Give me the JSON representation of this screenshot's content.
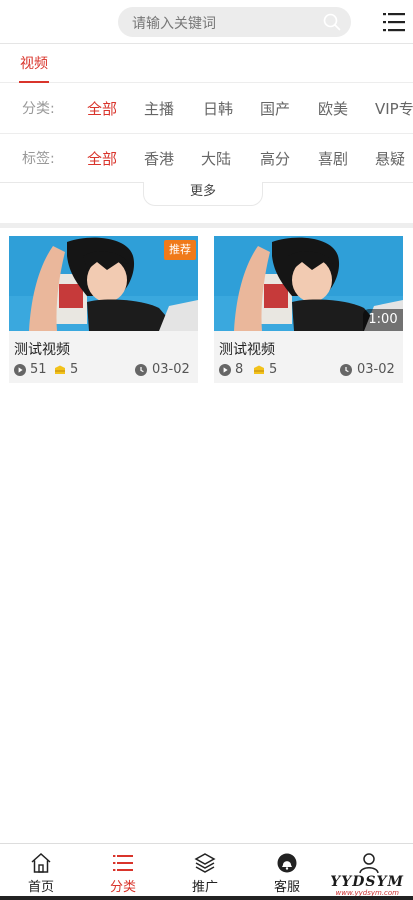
{
  "search": {
    "placeholder": "请输入关键词"
  },
  "tabs": [
    {
      "label": "视频",
      "active": true
    }
  ],
  "filters": {
    "category": {
      "label": "分类:",
      "options": [
        "全部",
        "主播",
        "日韩",
        "国产",
        "欧美",
        "VIP专"
      ],
      "active_index": 0
    },
    "tag": {
      "label": "标签:",
      "options": [
        "全部",
        "香港",
        "大陆",
        "高分",
        "喜剧",
        "悬疑"
      ],
      "active_index": 0
    }
  },
  "more_label": "更多",
  "videos": [
    {
      "title": "测试视频",
      "badge": "推荐",
      "duration": "",
      "plays": "51",
      "coins": "5",
      "date": "03-02"
    },
    {
      "title": "测试视频",
      "badge": "",
      "duration": "1:00",
      "plays": "8",
      "coins": "5",
      "date": "03-02"
    }
  ],
  "bottom_nav": [
    {
      "label": "首页",
      "icon": "home-icon",
      "active": false
    },
    {
      "label": "分类",
      "icon": "category-list-icon",
      "active": true
    },
    {
      "label": "推广",
      "icon": "layers-icon",
      "active": false
    },
    {
      "label": "客服",
      "icon": "customer-service-icon",
      "active": false
    },
    {
      "label": "我的",
      "icon": "user-icon",
      "active": false
    }
  ],
  "watermark": {
    "text": "YYDSYM",
    "sub": "www.yydsym.com"
  },
  "colors": {
    "accent": "#d9342b",
    "badge": "#f07a1a",
    "coin": "#f2c21b"
  }
}
